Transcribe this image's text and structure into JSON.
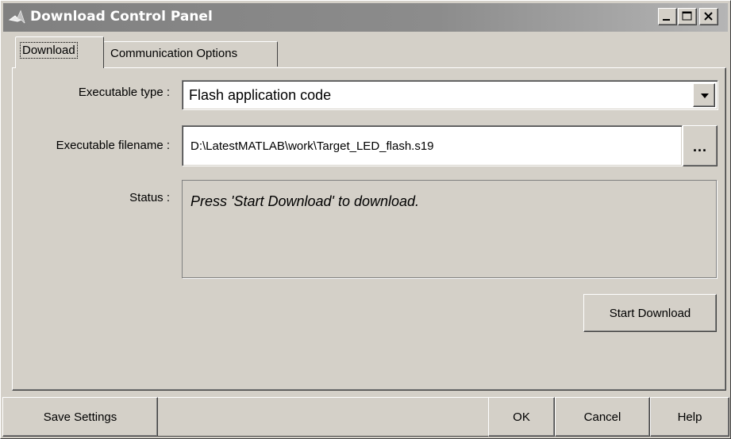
{
  "window": {
    "title": "Download Control Panel",
    "icon": "matlab-logo-icon",
    "controls": {
      "minimize_icon": "minimize-icon",
      "maximize_icon": "maximize-icon",
      "close_icon": "close-icon"
    }
  },
  "tabs": [
    {
      "label": "Download",
      "selected": true
    },
    {
      "label": "Communication Options",
      "selected": false
    }
  ],
  "form": {
    "executable_type": {
      "label": "Executable type :",
      "value": "Flash application code"
    },
    "executable_filename": {
      "label": "Executable filename :",
      "value": "D:\\LatestMATLAB\\work\\Target_LED_flash.s19",
      "browse_label": "..."
    },
    "status": {
      "label": "Status :",
      "value": "Press 'Start Download' to download."
    },
    "start_download_label": "Start Download"
  },
  "footer": {
    "save_label": "Save Settings",
    "ok_label": "OK",
    "cancel_label": "Cancel",
    "help_label": "Help"
  },
  "colors": {
    "face": "#d4d0c8",
    "titlebar_start": "#808080",
    "titlebar_end": "#b5b5b5",
    "title_text": "#ffffff"
  }
}
